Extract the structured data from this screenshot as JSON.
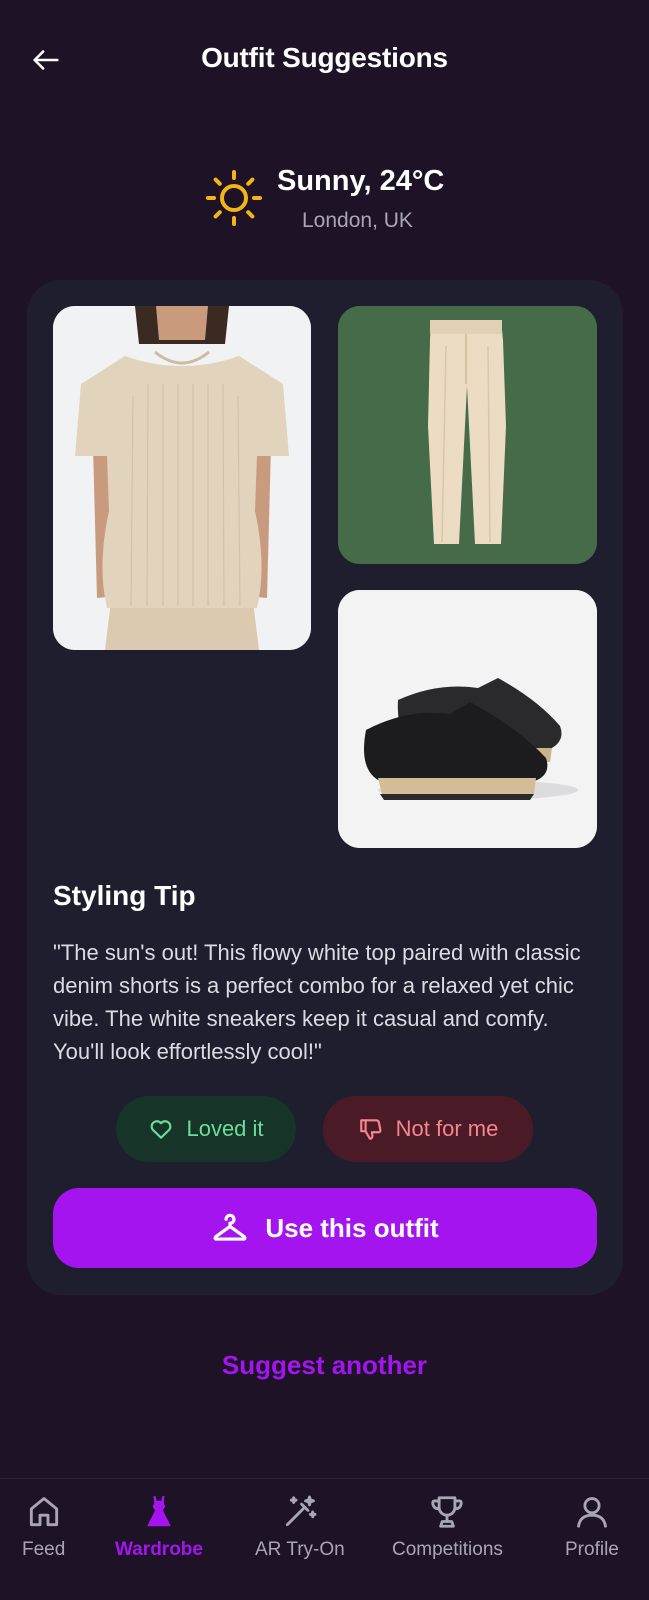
{
  "header": {
    "title": "Outfit Suggestions",
    "back_icon": "arrow-left-icon"
  },
  "weather": {
    "icon": "sun-icon",
    "condition": "Sunny, 24°C",
    "location": "London, UK"
  },
  "outfit": {
    "items": [
      {
        "name": "top",
        "image": "beige ribbed knit t-shirt"
      },
      {
        "name": "pants",
        "image": "cream tailored trousers"
      },
      {
        "name": "shoes",
        "image": "black slip-on sneakers with jute sole"
      }
    ]
  },
  "styling_tip": {
    "title": "Styling Tip",
    "text": "\"The sun's out! This flowy white top paired with classic denim shorts is a perfect combo for a relaxed yet chic vibe. The white sneakers keep it casual and comfy. You'll look effortlessly cool!\""
  },
  "reactions": {
    "loved_label": "Loved it",
    "not_for_me_label": "Not for me"
  },
  "actions": {
    "use_outfit_label": "Use this outfit",
    "suggest_another_label": "Suggest another"
  },
  "bottom_nav": {
    "items": [
      {
        "label": "Feed",
        "icon": "home-icon"
      },
      {
        "label": "Wardrobe",
        "icon": "dress-icon",
        "active": true
      },
      {
        "label": "AR Try-On",
        "icon": "magic-wand-icon"
      },
      {
        "label": "Competitions",
        "icon": "trophy-icon"
      },
      {
        "label": "Profile",
        "icon": "person-icon"
      }
    ]
  },
  "colors": {
    "background": "#1e1226",
    "card": "#1f1e2e",
    "accent": "#a414ef",
    "loved_bg": "#163428",
    "loved_fg": "#6ddc98",
    "dislike_bg": "#4a1b27",
    "dislike_fg": "#f5858f",
    "sun": "#f2b417"
  }
}
